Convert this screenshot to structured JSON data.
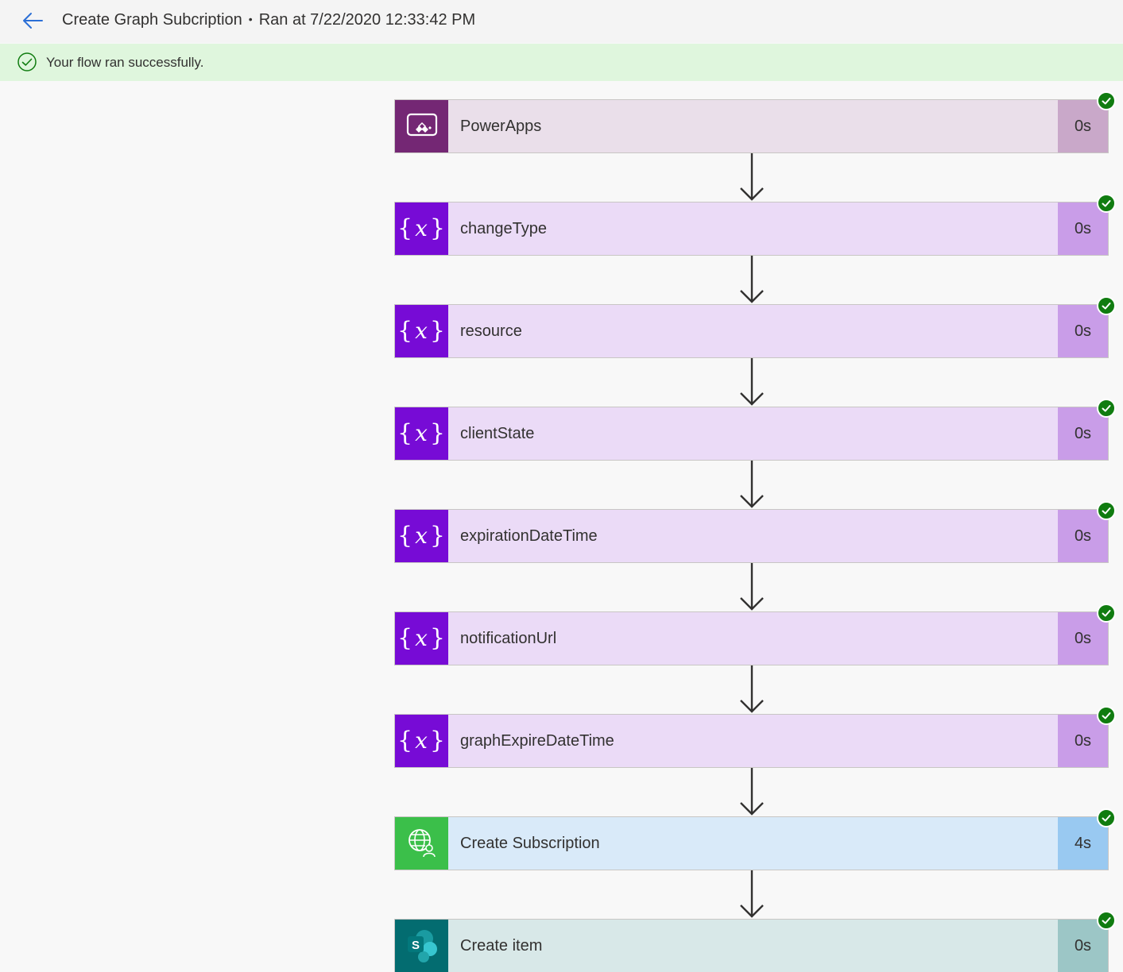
{
  "header": {
    "flow_name": "Create Graph Subcription",
    "separator": "•",
    "run_info": "Ran at 7/22/2020 12:33:42 PM"
  },
  "banner": {
    "message": "Your flow ran successfully."
  },
  "steps": [
    {
      "label": "PowerApps",
      "duration": "0s",
      "icon": "powerapps-icon"
    },
    {
      "label": "changeType",
      "duration": "0s",
      "icon": "variable-icon"
    },
    {
      "label": "resource",
      "duration": "0s",
      "icon": "variable-icon"
    },
    {
      "label": "clientState",
      "duration": "0s",
      "icon": "variable-icon"
    },
    {
      "label": "expirationDateTime",
      "duration": "0s",
      "icon": "variable-icon"
    },
    {
      "label": "notificationUrl",
      "duration": "0s",
      "icon": "variable-icon"
    },
    {
      "label": "graphExpireDateTime",
      "duration": "0s",
      "icon": "variable-icon"
    },
    {
      "label": "Create Subscription",
      "duration": "4s",
      "icon": "http-globe-icon"
    },
    {
      "label": "Create item",
      "duration": "0s",
      "icon": "sharepoint-icon"
    }
  ],
  "colors": {
    "powerapps": {
      "icon_bg": "#742774",
      "card_bg": "#eadfea",
      "dur_bg": "#c9a8c9"
    },
    "variable": {
      "icon_bg": "#770bd6",
      "card_bg": "#ebdbf7",
      "dur_bg": "#c99de8"
    },
    "http": {
      "icon_bg": "#3bbf4a",
      "card_bg": "#d9eaf9",
      "dur_bg": "#99c9f1"
    },
    "sharepoint": {
      "icon_bg": "#036c70",
      "card_bg": "#d8e8e8",
      "dur_bg": "#9cc6c6"
    },
    "success": "#107c10",
    "banner_bg": "#dff6dd"
  }
}
